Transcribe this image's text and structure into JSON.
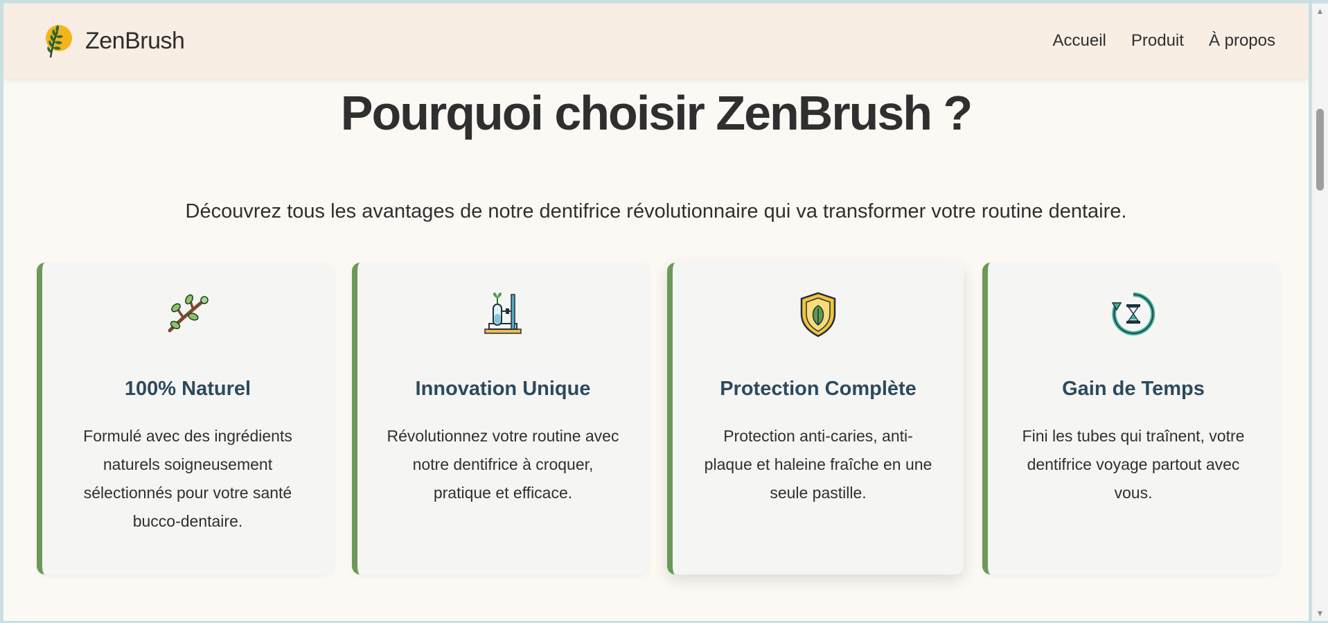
{
  "header": {
    "brand_name": "ZenBrush",
    "logo_icon": "leaf-sun-logo",
    "nav": [
      {
        "label": "Accueil"
      },
      {
        "label": "Produit"
      },
      {
        "label": "À propos"
      }
    ]
  },
  "main": {
    "title": "Pourquoi choisir ZenBrush ?",
    "subtitle": "Découvrez tous les avantages de notre dentifrice révolutionnaire qui va transformer votre routine dentaire."
  },
  "features": [
    {
      "icon": "branch-icon",
      "title": "100% Naturel",
      "text": "Formulé avec des ingrédients naturels soigneusement sélectionnés pour votre santé bucco-dentaire."
    },
    {
      "icon": "lab-test-tube-icon",
      "title": "Innovation Unique",
      "text": "Révolutionnez votre routine avec notre dentifrice à croquer, pratique et efficace."
    },
    {
      "icon": "leaf-shield-icon",
      "title": "Protection Complète",
      "text": "Protection anti-caries, anti-plaque et haleine fraîche en une seule pastille."
    },
    {
      "icon": "hourglass-cycle-icon",
      "title": "Gain de Temps",
      "text": "Fini les tubes qui traînent, votre dentifrice voyage partout avec vous."
    }
  ],
  "colors": {
    "accent_green": "#6b9a58",
    "header_bg": "#f8eee4",
    "page_bg": "#fcf9f4",
    "card_bg": "#f5f5f4",
    "card_title": "#2c4a5c"
  }
}
